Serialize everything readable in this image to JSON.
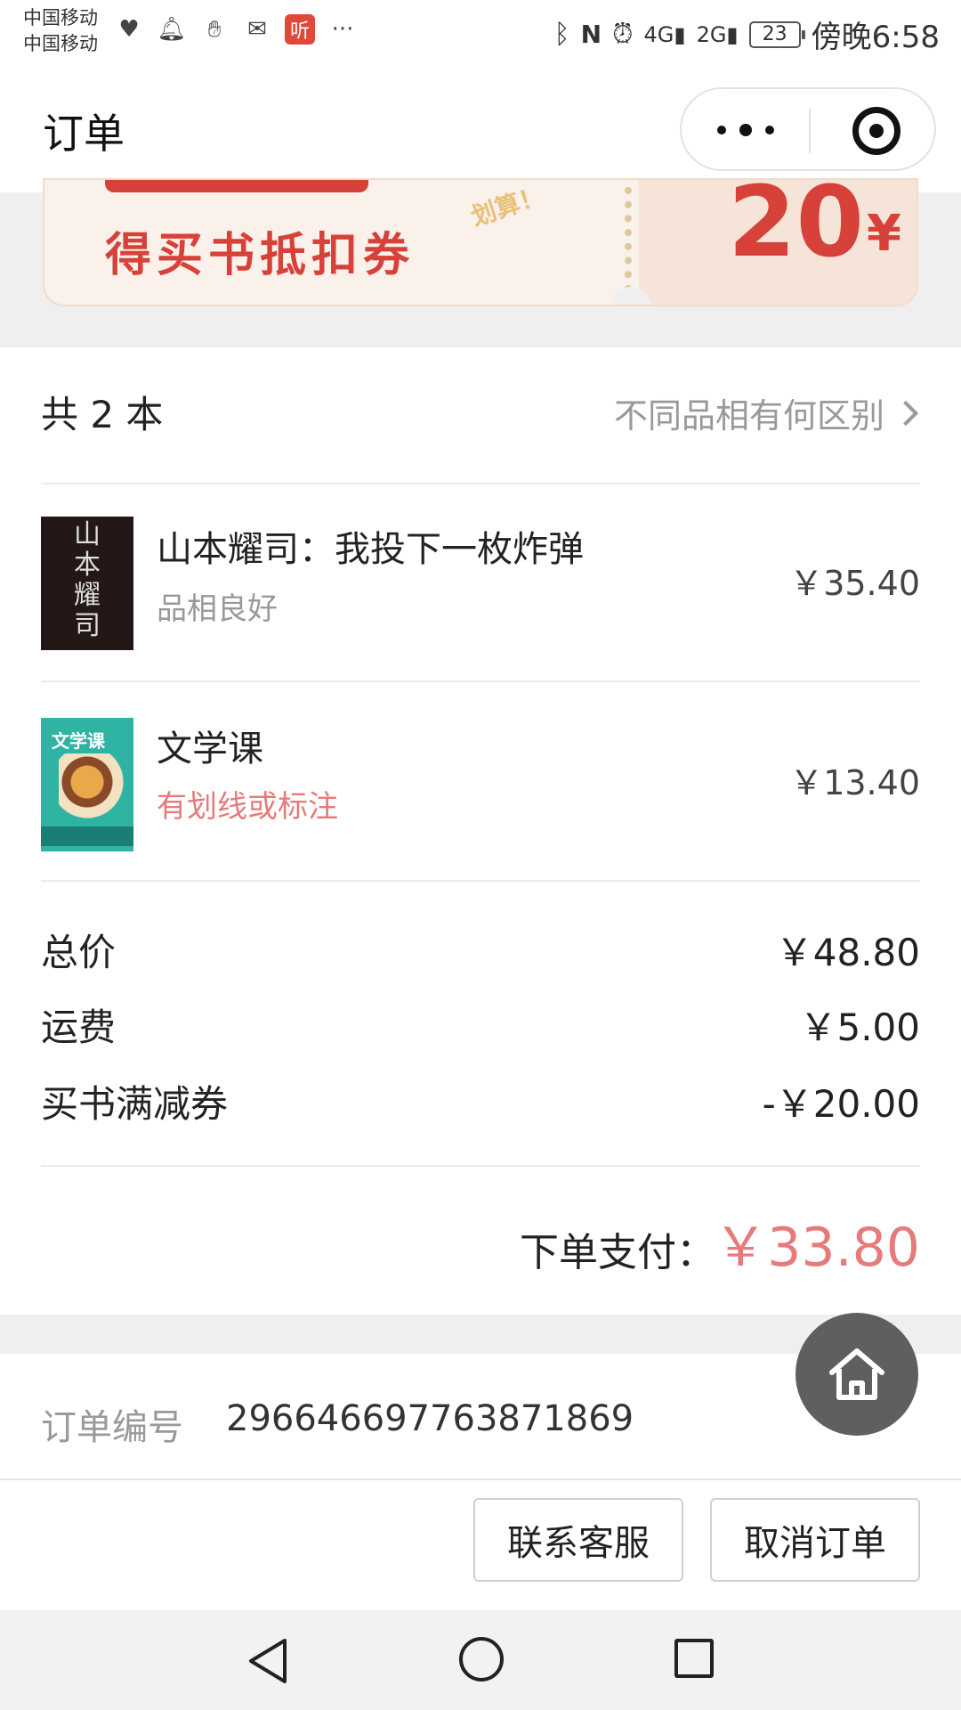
{
  "status_bar": {
    "carrier1": "中国移动",
    "carrier2": "中国移动",
    "notif_icons": [
      "heart-pulse-icon",
      "bell-icon",
      "hand-icon",
      "mail-icon",
      "listen-app-icon"
    ],
    "listen_label": "听",
    "more": "···",
    "battery": "23",
    "time": "傍晚6:58"
  },
  "navbar": {
    "title": "订单"
  },
  "coupon": {
    "text": "得买书抵扣券",
    "stamp": "划算！",
    "amount": "20",
    "currency": "¥"
  },
  "order": {
    "count_label": "共 2 本",
    "quality_link": "不同品相有何区别",
    "books": [
      {
        "title": "山本耀司：我投下一枚炸弹",
        "condition": "品相良好",
        "price": "￥35.40",
        "cover_text": [
          "山",
          "本",
          "耀",
          "司"
        ]
      },
      {
        "title": "文学课",
        "condition": "有划线或标注",
        "price": "￥13.40",
        "cover_text": [
          "文学课"
        ]
      }
    ],
    "summary": [
      {
        "label": "总价",
        "value": "￥48.80"
      },
      {
        "label": "运费",
        "value": "￥5.00"
      },
      {
        "label": "买书满减券",
        "value": "-￥20.00"
      }
    ],
    "pay_label": "下单支付：",
    "pay_value": "￥33.80"
  },
  "order_number": {
    "label": "订单编号",
    "value": "296646697763871869"
  },
  "actions": {
    "contact": "联系客服",
    "cancel": "取消订单"
  },
  "colors": {
    "accent_red": "#e57b7b",
    "coupon_red": "#d6423a"
  }
}
